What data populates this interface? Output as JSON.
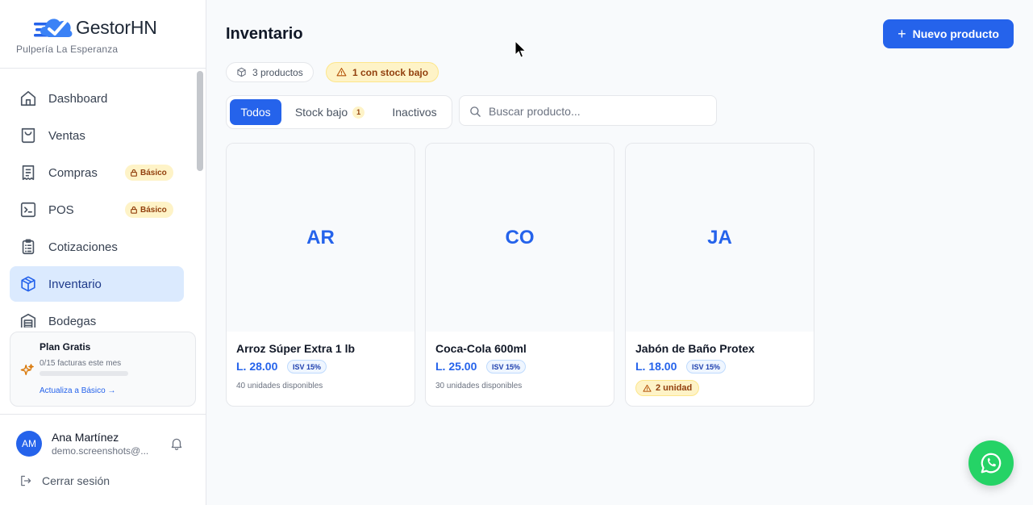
{
  "app": {
    "name": "GestorHN",
    "store_name": "Pulpería La Esperanza"
  },
  "colors": {
    "accent": "#2563eb",
    "warning_bg": "#fef3c7",
    "warning_text": "#92400e",
    "whatsapp": "#25d366"
  },
  "sidebar": {
    "items": [
      {
        "label": "Dashboard",
        "icon": "home-icon"
      },
      {
        "label": "Ventas",
        "icon": "shopping-bag-icon"
      },
      {
        "label": "Compras",
        "icon": "receipt-icon",
        "badge": "Básico"
      },
      {
        "label": "POS",
        "icon": "terminal-icon",
        "badge": "Básico"
      },
      {
        "label": "Cotizaciones",
        "icon": "clipboard-icon"
      },
      {
        "label": "Inventario",
        "icon": "box-icon",
        "active": true
      },
      {
        "label": "Bodegas",
        "icon": "warehouse-icon"
      }
    ],
    "plan": {
      "title": "Plan Gratis",
      "usage_text": "0/15 facturas este mes",
      "usage_fraction": 0,
      "upgrade_link": "Actualiza a Básico →",
      "icon": "sparkles-icon"
    },
    "user": {
      "initials": "AM",
      "name": "Ana Martínez",
      "email": "demo.screenshots@...",
      "notification_icon": "bell-icon"
    },
    "logout_label": "Cerrar sesión"
  },
  "main": {
    "title": "Inventario",
    "new_button": "Nuevo producto",
    "summary": {
      "count_label": "3 productos",
      "low_stock_label": "1 con stock bajo"
    },
    "tabs": [
      {
        "label": "Todos",
        "active": true
      },
      {
        "label": "Stock bajo",
        "count": "1"
      },
      {
        "label": "Inactivos"
      }
    ],
    "search": {
      "placeholder": "Buscar producto..."
    },
    "products": [
      {
        "initials": "AR",
        "name": "Arroz Súper Extra 1 lb",
        "price": "L. 28.00",
        "tax_badge": "ISV 15%",
        "stock_text": "40 unidades disponibles",
        "low_stock": false
      },
      {
        "initials": "CO",
        "name": "Coca-Cola 600ml",
        "price": "L. 25.00",
        "tax_badge": "ISV 15%",
        "stock_text": "30 unidades disponibles",
        "low_stock": false
      },
      {
        "initials": "JA",
        "name": "Jabón de Baño Protex",
        "price": "L. 18.00",
        "tax_badge": "ISV 15%",
        "stock_text": "2 unidad",
        "low_stock": true
      }
    ]
  }
}
